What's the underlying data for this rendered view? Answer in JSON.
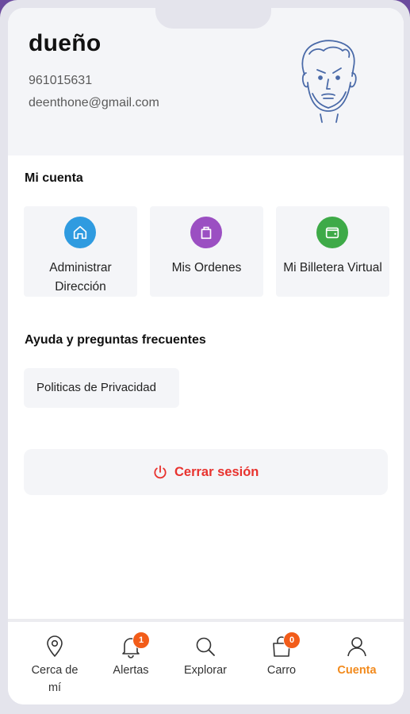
{
  "profile": {
    "name": "dueño",
    "phone": "961015631",
    "email": "deenthone@gmail.com"
  },
  "account_section": {
    "title": "Mi cuenta",
    "cards": [
      {
        "label_line1": "Administrar",
        "label_line2": "Dirección",
        "icon": "home-icon",
        "color": "#2f9be0"
      },
      {
        "label": "Mis Ordenes",
        "icon": "shopping-bag-icon",
        "color": "#9b4fc2"
      },
      {
        "label": "Mi Billetera Virtual",
        "icon": "wallet-icon",
        "color": "#3eaa48"
      }
    ]
  },
  "help_section": {
    "title": "Ayuda y preguntas frecuentes",
    "privacy_label": "Politicas de Privacidad"
  },
  "logout": {
    "label": "Cerrar sesión",
    "color": "#e8322e"
  },
  "bottom_nav": {
    "items": [
      {
        "label_line1": "Cerca de",
        "label_line2": "mí",
        "icon": "map-pin-icon"
      },
      {
        "label": "Alertas",
        "icon": "bell-icon",
        "badge": "1"
      },
      {
        "label": "Explorar",
        "icon": "search-icon"
      },
      {
        "label": "Carro",
        "icon": "cart-bag-icon",
        "badge": "0"
      },
      {
        "label": "Cuenta",
        "icon": "user-icon",
        "active": true
      }
    ],
    "active_color": "#f28a1c",
    "badge_color": "#f25c19"
  }
}
